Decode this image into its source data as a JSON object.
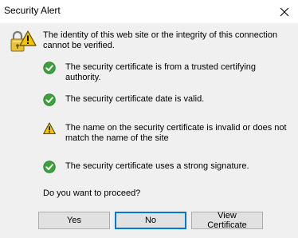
{
  "window": {
    "title": "Security Alert"
  },
  "intro": "The identity of this web site or the integrity of this connection cannot be verified.",
  "checks": [
    {
      "status": "ok",
      "icon": "green-check-icon",
      "text": "The security certificate is from a trusted certifying authority."
    },
    {
      "status": "ok",
      "icon": "green-check-icon",
      "text": "The security certificate date is valid."
    },
    {
      "status": "warning",
      "icon": "warning-icon",
      "text": "The name on the security certificate is invalid or does not match the name of the site"
    },
    {
      "status": "ok",
      "icon": "green-check-icon",
      "text": "The security certificate uses a strong signature."
    }
  ],
  "question": "Do you want to proceed?",
  "buttons": {
    "yes": "Yes",
    "no": "No",
    "view_certificate": "View Certificate"
  },
  "colors": {
    "ok_green": "#3aa23a",
    "warning_yellow": "#f5c400",
    "default_button_border": "#0078d7"
  }
}
